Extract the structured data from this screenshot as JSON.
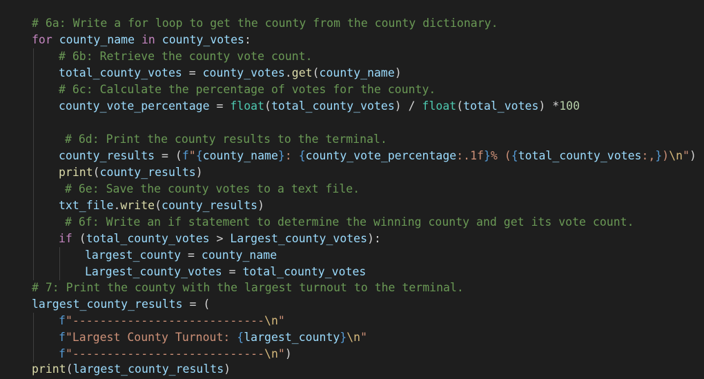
{
  "code": {
    "l1": {
      "comment": "# 6a: Write a for loop to get the county from the county dictionary."
    },
    "l2": {
      "kw_for": "for",
      "var1": "county_name",
      "kw_in": " in ",
      "var2": "county_votes",
      "colon": ":"
    },
    "l3": {
      "comment": "# 6b: Retrieve the county vote count."
    },
    "l4": {
      "var1": "total_county_votes",
      "op": " = ",
      "var2": "county_votes",
      "dot": ".",
      "fn": "get",
      "open": "(",
      "arg": "county_name",
      "close": ")"
    },
    "l5": {
      "comment": "# 6c: Calculate the percentage of votes for the county."
    },
    "l6": {
      "var1": "county_vote_percentage",
      "op": " = ",
      "fn1": "float",
      "open1": "(",
      "arg1": "total_county_votes",
      "close1": ")",
      "div": " / ",
      "fn2": "float",
      "open2": "(",
      "arg2": "total_votes",
      "close2": ")",
      "mul": " *",
      "num": "100"
    },
    "l8": {
      "comment": "# 6d: Print the county results to the terminal."
    },
    "l9": {
      "var1": "county_results",
      "op": " = (",
      "f": "f",
      "q1": "\"",
      "b1": "{",
      "v1": "county_name",
      "b2": "}",
      "s1": ": ",
      "b3": "{",
      "v2": "county_vote_percentage",
      "fmt1": ":.1f",
      "b4": "}",
      "s2": "% (",
      "b5": "{",
      "v3": "total_county_votes",
      "fmt2": ":,",
      "b6": "}",
      "s3": ")",
      "esc": "\\n",
      "q2": "\"",
      "close": ")"
    },
    "l10": {
      "fn": "print",
      "open": "(",
      "arg": "county_results",
      "close": ")"
    },
    "l11": {
      "comment": "# 6e: Save the county votes to a text file."
    },
    "l12": {
      "var1": "txt_file",
      "dot": ".",
      "fn": "write",
      "open": "(",
      "arg": "county_results",
      "close": ")"
    },
    "l13": {
      "comment": "# 6f: Write an if statement to determine the winning county and get its vote count."
    },
    "l14": {
      "kw": "if",
      "open": " (",
      "var1": "total_county_votes",
      "op": " > ",
      "var2": "Largest_county_votes",
      "close": "):"
    },
    "l15": {
      "var1": "largest_county",
      "op": " = ",
      "var2": "county_name"
    },
    "l16": {
      "var1": "Largest_county_votes",
      "op": " = ",
      "var2": "total_county_votes"
    },
    "l17": {
      "comment": "# 7: Print the county with the largest turnout to the terminal."
    },
    "l18": {
      "var1": "largest_county_results",
      "op": " = ("
    },
    "l19": {
      "f": "f",
      "str": "\"----------------------------",
      "esc": "\\n",
      "q": "\""
    },
    "l20": {
      "f": "f",
      "str": "\"Largest County Turnout: ",
      "b1": "{",
      "v": "largest_county",
      "b2": "}",
      "esc": "\\n",
      "q": "\""
    },
    "l21": {
      "f": "f",
      "str": "\"----------------------------",
      "esc": "\\n",
      "q": "\"",
      "close": ")"
    },
    "l22": {
      "fn": "print",
      "open": "(",
      "arg": "largest_county_results",
      "close": ")"
    }
  }
}
